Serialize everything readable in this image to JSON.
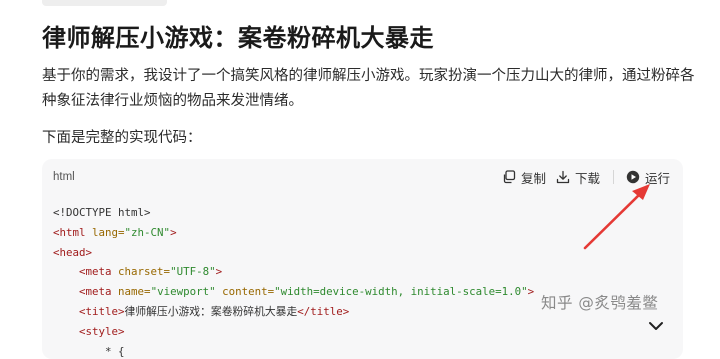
{
  "page": {
    "title": "律师解压小游戏：案卷粉碎机大暴走",
    "intro": "基于你的需求，我设计了一个搞笑风格的律师解压小游戏。玩家扮演一个压力山大的律师，通过粉碎各种象征法律行业烦恼的物品来发泄情绪。",
    "code_intro": "下面是完整的实现代码："
  },
  "code_block": {
    "language": "html",
    "copy_label": "复制",
    "download_label": "下载",
    "run_label": "运行",
    "lines": {
      "l1": "<!DOCTYPE html>",
      "l2_open": "<html",
      "l2_attr": "lang=",
      "l2_val": "\"zh-CN\"",
      "l2_close": ">",
      "l3": "<head>",
      "l4_open": "<meta",
      "l4_attr": "charset=",
      "l4_val": "\"UTF-8\"",
      "l4_close": ">",
      "l5_open": "<meta",
      "l5_attr1": "name=",
      "l5_val1": "\"viewport\"",
      "l5_attr2": "content=",
      "l5_val2": "\"width=device-width, initial-scale=1.0\"",
      "l5_close": ">",
      "l6_open": "<title>",
      "l6_text": "律师解压小游戏：案卷粉碎机大暴走",
      "l6_close": "</title>",
      "l7": "<style>",
      "l8": "* {"
    }
  },
  "watermark": "知乎 @炙鸮羞鳖",
  "colors": {
    "accent_arrow": "#e53935",
    "code_bg": "#f7f7f8",
    "tag": "#a11d1d",
    "string": "#2f8a2f",
    "attr": "#986801"
  },
  "icons": [
    "copy-icon",
    "download-icon",
    "play-circle-icon",
    "chevron-down-icon"
  ]
}
